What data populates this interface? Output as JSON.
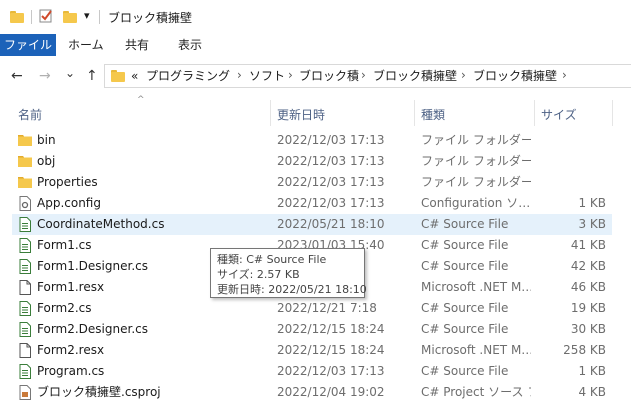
{
  "window": {
    "title": "ブロック積擁壁",
    "qa_dropdown": "▾"
  },
  "ribbon": {
    "tabs": [
      "ファイル",
      "ホーム",
      "共有",
      "表示"
    ]
  },
  "nav": {
    "back": "←",
    "forward": "→",
    "recent": "⌄",
    "up": "↑",
    "overflow": "«",
    "breadcrumbs": [
      "プログラミング",
      "ソフト",
      "ブロック積",
      "ブロック積擁壁",
      "ブロック積擁壁"
    ],
    "separator": "›"
  },
  "columns": {
    "name": "名前",
    "date": "更新日時",
    "type": "種類",
    "size": "サイズ"
  },
  "files": [
    {
      "name": "bin",
      "date": "2022/12/03 17:13",
      "type": "ファイル フォルダー",
      "size": "",
      "icon": "folder-icon"
    },
    {
      "name": "obj",
      "date": "2022/12/03 17:13",
      "type": "ファイル フォルダー",
      "size": "",
      "icon": "folder-icon"
    },
    {
      "name": "Properties",
      "date": "2022/12/03 17:13",
      "type": "ファイル フォルダー",
      "size": "",
      "icon": "folder-icon"
    },
    {
      "name": "App.config",
      "date": "2022/12/03 17:13",
      "type": "Configuration ソ…",
      "size": "1 KB",
      "icon": "config-file-icon"
    },
    {
      "name": "CoordinateMethod.cs",
      "date": "2022/05/21 18:10",
      "type": "C# Source File",
      "size": "3 KB",
      "icon": "cs-file-icon",
      "selected": true
    },
    {
      "name": "Form1.cs",
      "date": "2023/01/03 15:40",
      "type": "C# Source File",
      "size": "41 KB",
      "icon": "cs-file-icon"
    },
    {
      "name": "Form1.Designer.cs",
      "date": "",
      "type": "C# Source File",
      "size": "42 KB",
      "icon": "cs-file-icon"
    },
    {
      "name": "Form1.resx",
      "date": "",
      "type": "Microsoft .NET M…",
      "size": "46 KB",
      "icon": "resx-file-icon"
    },
    {
      "name": "Form2.cs",
      "date": "2022/12/21 7:18",
      "type": "C# Source File",
      "size": "19 KB",
      "icon": "cs-file-icon"
    },
    {
      "name": "Form2.Designer.cs",
      "date": "2022/12/15 18:24",
      "type": "C# Source File",
      "size": "30 KB",
      "icon": "cs-file-icon"
    },
    {
      "name": "Form2.resx",
      "date": "2022/12/15 18:24",
      "type": "Microsoft .NET M…",
      "size": "258 KB",
      "icon": "resx-file-icon"
    },
    {
      "name": "Program.cs",
      "date": "2022/12/03 17:13",
      "type": "C# Source File",
      "size": "1 KB",
      "icon": "cs-file-icon"
    },
    {
      "name": "ブロック積擁壁.csproj",
      "date": "2022/12/04 19:02",
      "type": "C# Project ソース フ…",
      "size": "4 KB",
      "icon": "csproj-file-icon"
    }
  ],
  "tooltip": {
    "type_line": "種類: C# Source File",
    "size_line": "サイズ: 2.57 KB",
    "date_line": "更新日時: 2022/05/21 18:10"
  },
  "colors": {
    "file_tab": "#1c62b9",
    "selection": "#e5f1fb",
    "folder": "#f5c84c",
    "header_text": "#4d6185"
  }
}
